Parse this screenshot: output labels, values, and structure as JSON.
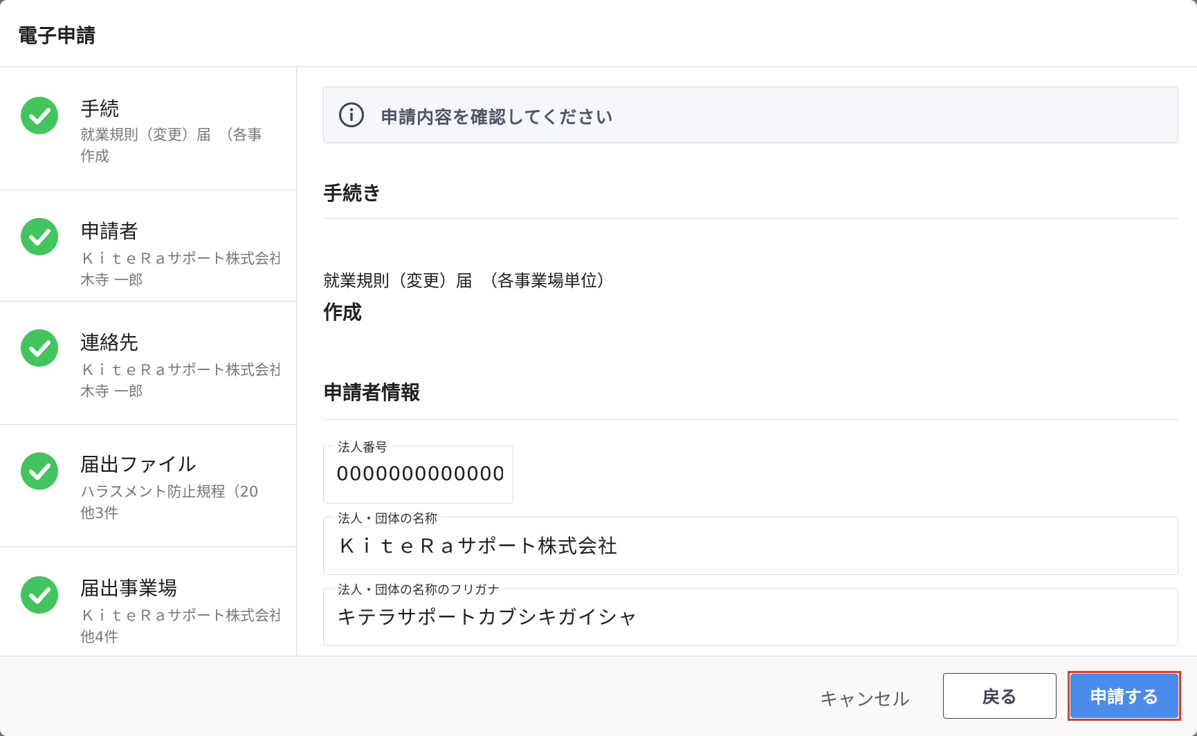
{
  "modal": {
    "title": "電子申請"
  },
  "sidebar": {
    "steps": [
      {
        "title": "手続",
        "lines": [
          "就業規則（変更）届　（各事",
          "作成"
        ]
      },
      {
        "title": "申請者",
        "lines": [
          "ＫｉｔｅＲａサポート株式会社",
          "木寺 一郎"
        ]
      },
      {
        "title": "連絡先",
        "lines": [
          "ＫｉｔｅＲａサポート株式会社",
          "木寺 一郎"
        ]
      },
      {
        "title": "届出ファイル",
        "lines": [
          "ハラスメント防止規程（20",
          "他3件"
        ]
      },
      {
        "title": "届出事業場",
        "lines": [
          "ＫｉｔｅＲａサポート株式会社",
          "他4件"
        ]
      }
    ]
  },
  "alert": {
    "icon": "info-icon",
    "text": "申請内容を確認してください"
  },
  "procedure": {
    "section_title": "手続き",
    "name": "就業規則（変更）届　（各事業場単位）",
    "action": "作成"
  },
  "applicant": {
    "section_title": "申請者情報",
    "corporate_number": {
      "label": "法人番号",
      "value": "0000000000000"
    },
    "org_name": {
      "label": "法人・団体の名称",
      "value": "ＫｉｔｅＲａサポート株式会社"
    },
    "org_name_kana": {
      "label": "法人・団体の名称のフリガナ",
      "value": "キテラサポートカブシキガイシャ"
    }
  },
  "footer": {
    "cancel_label": "キャンセル",
    "back_label": "戻る",
    "submit_label": "申請する"
  },
  "colors": {
    "accent": "#4b8bec",
    "success": "#43c55e",
    "highlight": "#e23b2e"
  }
}
